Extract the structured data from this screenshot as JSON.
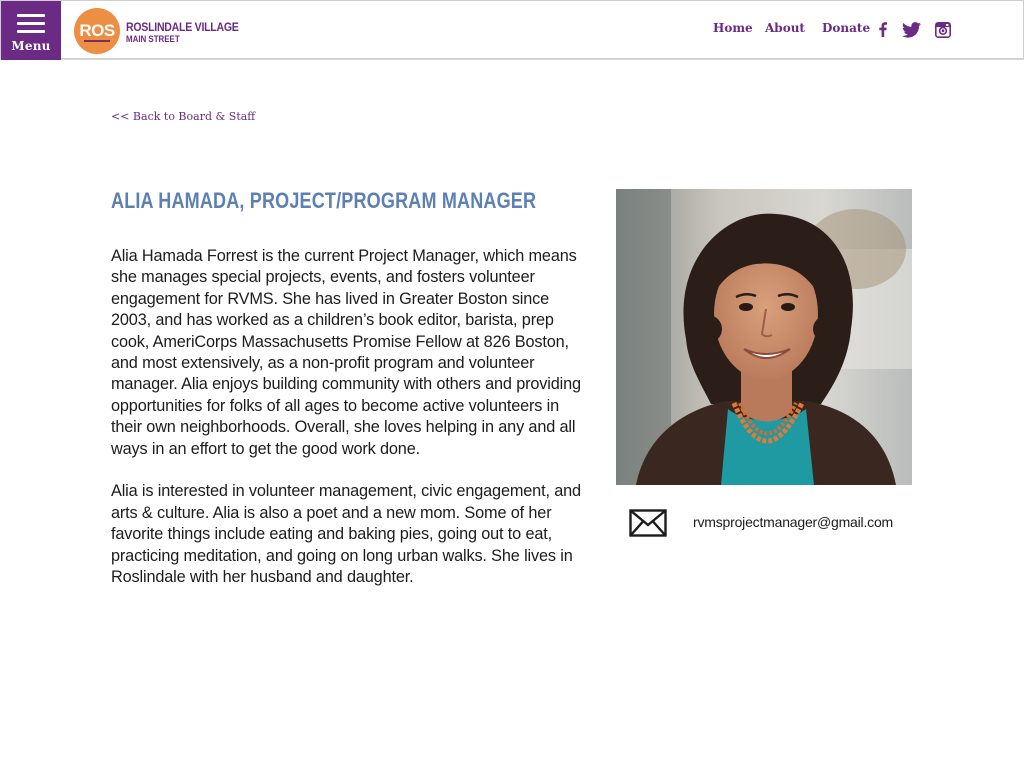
{
  "header": {
    "menu_label": "Menu",
    "logo": {
      "mark": "ROS",
      "line1": "ROSLINDALE VILLAGE",
      "line2": "MAIN STREET"
    },
    "nav": {
      "home": "Home",
      "about": "About",
      "donate": "Donate"
    },
    "social_icons": [
      "facebook-icon",
      "twitter-icon",
      "instagram-icon"
    ]
  },
  "main": {
    "back_link": "<< Back to Board & Staff",
    "title": "ALIA HAMADA, PROJECT/PROGRAM MANAGER",
    "bio": [
      "Alia Hamada Forrest is the current Project Manager, which means she manages special projects, events, and fosters volunteer engagement for RVMS. She has lived in Greater Boston since 2003, and has worked as a children’s book editor, barista, prep cook, AmeriCorps Massachusetts Promise Fellow at 826 Boston, and most extensively, as a non-profit program and volunteer manager. Alia enjoys building community with others and providing opportunities for folks of all ages to become active volunteers in their own neighborhoods. Overall, she loves helping in any and all ways in an effort to get the good work done.",
      "Alia is interested in volunteer management, civic engagement, and arts & culture. Alia is also a poet and a new mom. Some of her favorite things include eating and baking pies, going out to eat, practicing meditation, and going on long urban walks. She lives in Roslindale with her husband and daughter."
    ],
    "email": "rvmsprojectmanager@gmail.com"
  },
  "colors": {
    "brand_purple": "#6b2a84",
    "logo_orange": "#ec8e43",
    "title_blue": "#5c7fb4"
  }
}
